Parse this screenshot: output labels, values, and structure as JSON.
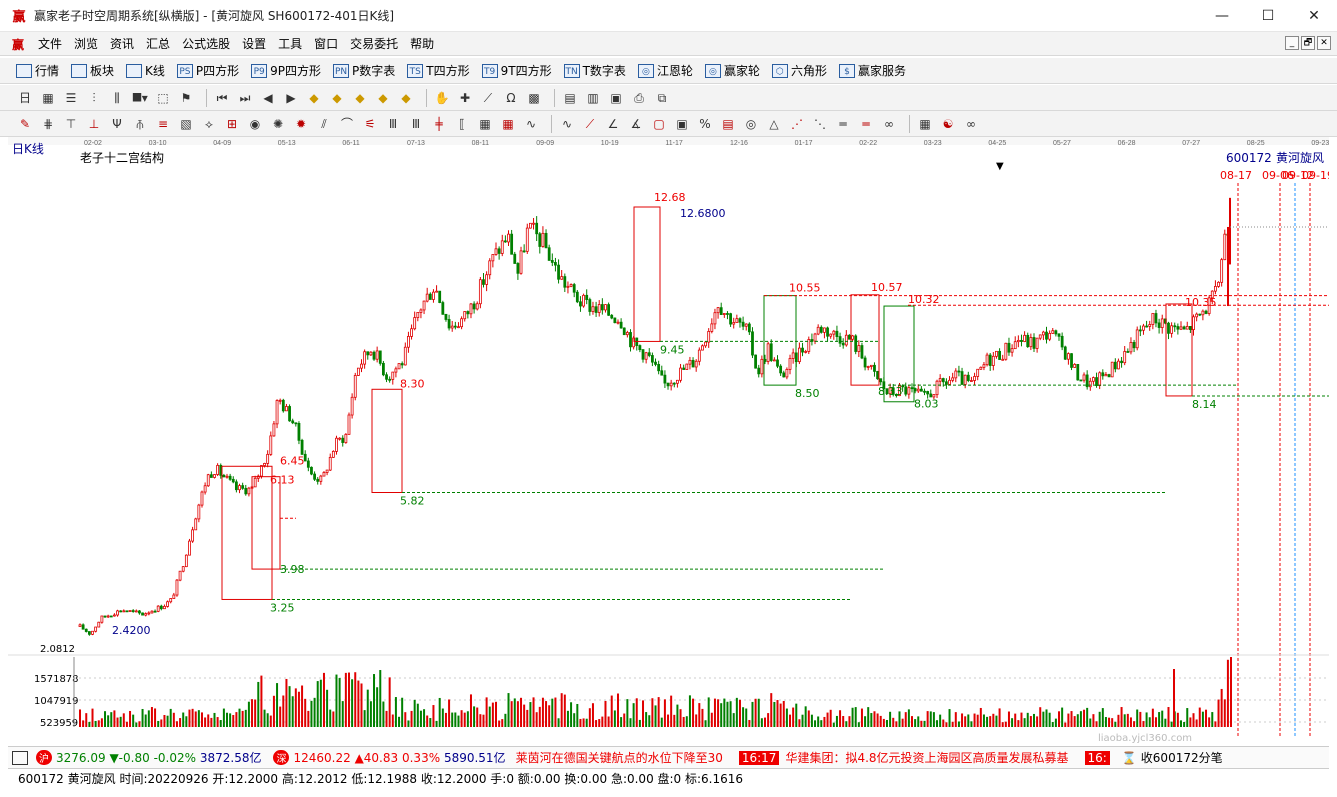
{
  "window": {
    "title": "赢家老子时空周期系统[纵横版] - [黄河旋风  SH600172-401日K线]",
    "minimize": "—",
    "maximize": "☐",
    "close": "✕"
  },
  "menu": {
    "items": [
      "文件",
      "浏览",
      "资讯",
      "汇总",
      "公式选股",
      "设置",
      "工具",
      "窗口",
      "交易委托",
      "帮助"
    ],
    "mdi": [
      "_",
      "🗗",
      "✕"
    ]
  },
  "toolbar1": {
    "items": [
      {
        "label": "行情",
        "icon": "grid-icon"
      },
      {
        "label": "板块",
        "icon": "blocks-icon"
      },
      {
        "label": "K线",
        "icon": "kline-icon"
      },
      {
        "label": "P四方形",
        "icon": "ps-icon",
        "tag": "PS"
      },
      {
        "label": "9P四方形",
        "icon": "p9-icon",
        "tag": "P9"
      },
      {
        "label": "P数字表",
        "icon": "pn-icon",
        "tag": "PN"
      },
      {
        "label": "T四方形",
        "icon": "ts-icon",
        "tag": "TS"
      },
      {
        "label": "9T四方形",
        "icon": "t9-icon",
        "tag": "T9"
      },
      {
        "label": "T数字表",
        "icon": "tn-icon",
        "tag": "TN"
      },
      {
        "label": "江恩轮",
        "icon": "gann-wheel-icon",
        "tag": "◎"
      },
      {
        "label": "赢家轮",
        "icon": "winner-wheel-icon",
        "tag": "◎"
      },
      {
        "label": "六角形",
        "icon": "hexagon-icon",
        "tag": "⬡"
      },
      {
        "label": "赢家服务",
        "icon": "dollar-icon",
        "tag": "$"
      }
    ]
  },
  "chart": {
    "period_label": "日K线",
    "indicator_name": "老子十二宫结构",
    "stock_code": "600172",
    "stock_name": "黄河旋风",
    "date_axis": [
      "02-02",
      "03-10",
      "04-09",
      "05-13",
      "06-11",
      "07-13",
      "08-11",
      "09-09",
      "10-19",
      "11-17",
      "12-16",
      "01-17",
      "02-22",
      "03-23",
      "04-25",
      "05-27",
      "06-28",
      "07-27",
      "08-25",
      "09-23"
    ],
    "future_dates": [
      "08-17",
      "09-06",
      "09-12",
      "09-19"
    ],
    "price_labels": {
      "low_start": "2.4200",
      "p325": "3.25",
      "p398": "3.98",
      "p645": "6.45",
      "p613": "6.13",
      "p582": "5.82",
      "p830": "8.30",
      "p945": "9.45",
      "p1268": "12.68",
      "p126800": "12.6800",
      "p1055": "10.55",
      "p1057": "10.57",
      "p1032": "10.32",
      "p1035": "10.35",
      "p850": "8.50",
      "p833": "8.33",
      "p803": "8.03",
      "p814": "8.14"
    },
    "volume_axis": [
      "2.0812",
      "1571878",
      "1047919",
      "523959"
    ],
    "colors": {
      "up": "#e00000",
      "down": "#008000",
      "guide": "#008000",
      "box_red": "#e00000",
      "box_green": "#008000"
    }
  },
  "status": {
    "sh_index": "3276.09",
    "sh_change": "▼-0.80",
    "sh_pct": "-0.02%",
    "sh_amount": "3872.58亿",
    "sz_index": "12460.22",
    "sz_change": "▲40.83",
    "sz_pct": "0.33%",
    "sz_amount": "5890.51亿",
    "news1": "莱茵河在德国关键航点的水位下降至30",
    "news_time": "16:17",
    "news2": "华建集团：拟4.8亿元投资上海园区高质量发展私募基",
    "news_time2": "16:",
    "sound": "收600172分笔"
  },
  "status2": {
    "text": "600172 黄河旋风 时间:20220926 开:12.2000 高:12.2012 低:12.1988 收:12.2000 手:0 额:0.00 换:0.00 急:0.00 盘:0 标:6.1616"
  },
  "watermark": "liaoba.yjcl360.com"
}
